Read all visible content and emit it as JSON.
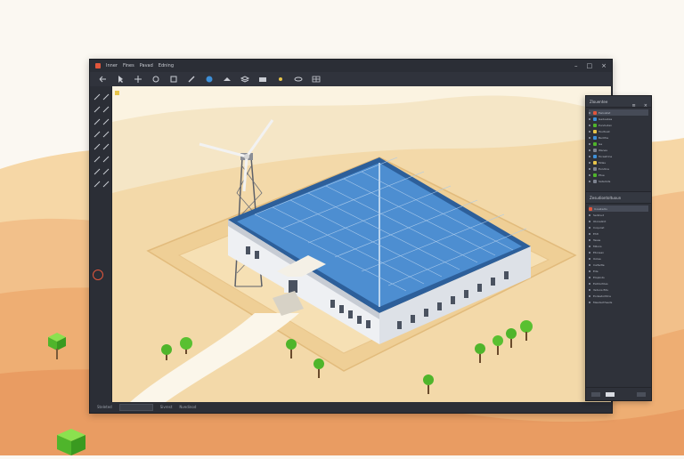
{
  "menu": {
    "items": [
      "Inner",
      "Fines",
      "Pavad",
      "Edning"
    ]
  },
  "toolbar": {
    "buttons": [
      {
        "icon": "undo-icon"
      },
      {
        "icon": "cursor-icon"
      },
      {
        "icon": "move-icon"
      },
      {
        "icon": "rotate-icon"
      },
      {
        "icon": "scale-icon"
      },
      {
        "icon": "brush-icon"
      },
      {
        "icon": "globe-icon"
      },
      {
        "icon": "paint-icon"
      },
      {
        "icon": "layers-icon"
      },
      {
        "icon": "camera-icon"
      },
      {
        "icon": "light-icon"
      },
      {
        "icon": "eye-icon"
      },
      {
        "icon": "grid-icon"
      }
    ]
  },
  "outliner": {
    "title": "Zlouentee",
    "items": [
      "Ewisistet",
      "Geduebas",
      "Pundudan",
      "Toultivet",
      "Bedifos",
      "Ge",
      "Wanes",
      "Tocastrine",
      "Mdas",
      "Evodine",
      "Ptue",
      "Sataduts"
    ]
  },
  "properties": {
    "title": "Zesudiontoltuoun",
    "header": "Uosatedis",
    "items": [
      "Sedinud",
      "Olonalinit",
      "Coqunst",
      "Ehlt",
      "Tesas",
      "Miluns",
      "Etonsan",
      "Oolae",
      "Caifedte",
      "Ede",
      "Eloplnds",
      "Eatdoctiles",
      "Yeduns Eds",
      "Eodestortitns",
      "Mesdacthseds"
    ]
  },
  "status": {
    "items": [
      "Steleted",
      "Sivrest",
      "Nvedinod"
    ]
  },
  "colors": {
    "accent": "#e2563c",
    "panel": "#2b2e36",
    "sand": "#f2c98e",
    "solar": "#4d8ed1"
  }
}
